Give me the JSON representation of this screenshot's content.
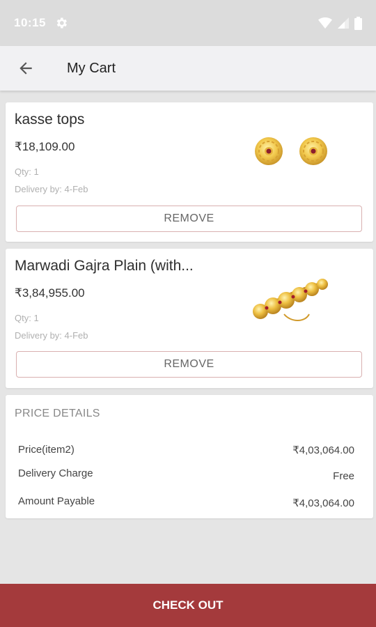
{
  "status_bar": {
    "time": "10:15",
    "icons": [
      "gear-icon",
      "wifi-icon",
      "signal-icon",
      "battery-icon"
    ]
  },
  "app_bar": {
    "title": "My Cart",
    "back_icon": "arrow-back-icon"
  },
  "cart_items": [
    {
      "name": "kasse tops",
      "price": "₹18,109.00",
      "qty": "Qty: 1",
      "delivery": "Delivery by: 4-Feb",
      "image_icon": "gold-earrings-image",
      "remove_label": "REMOVE"
    },
    {
      "name": "Marwadi Gajra Plain (with...",
      "price": "₹3,84,955.00",
      "qty": "Qty: 1",
      "delivery": "Delivery by: 4-Feb",
      "image_icon": "gold-bracelet-image",
      "remove_label": "REMOVE"
    }
  ],
  "price_details": {
    "heading": "PRICE DETAILS",
    "rows": [
      {
        "label": "Price(item2)",
        "value": "₹4,03,064.00"
      },
      {
        "label": "Delivery Charge",
        "value": "Free"
      },
      {
        "label": "Amount Payable",
        "value": "₹4,03,064.00"
      }
    ]
  },
  "checkout_label": "CHECK OUT",
  "colors": {
    "accent": "#a43a3c",
    "status_bar": "#dcdcdc",
    "app_bar": "#f1f1f3",
    "background": "#e5e5e5"
  }
}
